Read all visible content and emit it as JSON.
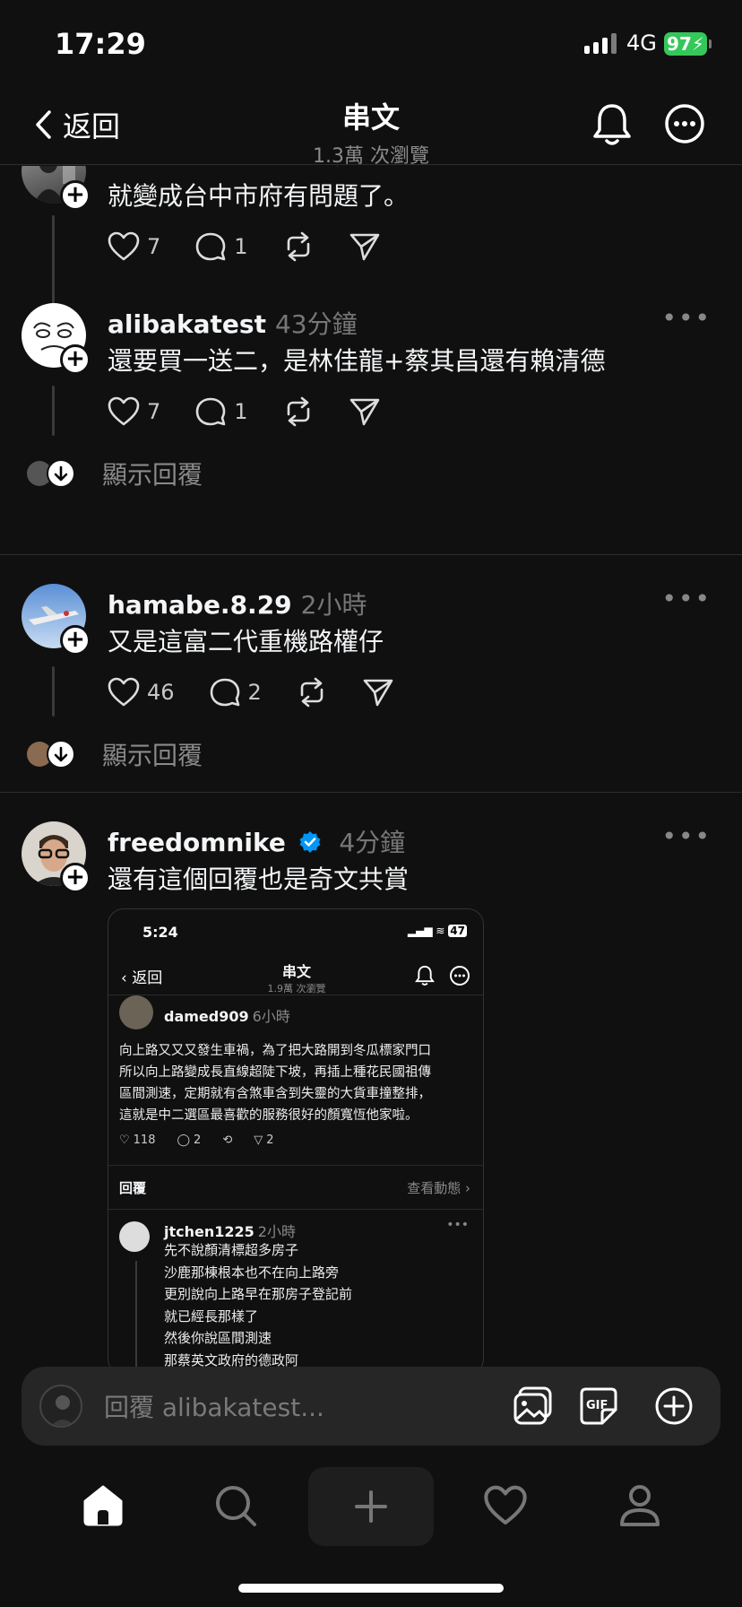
{
  "status": {
    "time": "17:29",
    "network": "4G",
    "battery": "97"
  },
  "header": {
    "back_label": "返回",
    "title": "串文",
    "subtitle": "1.3萬 次瀏覽"
  },
  "posts": [
    {
      "username": "",
      "time": "",
      "text": "如果市長還是林佳龍，\n就變成台中市府有問題了。",
      "likes": "7",
      "replies": "1"
    },
    {
      "username": "alibakatest",
      "time": "43分鐘",
      "text": "還要買一送二，是林佳龍+蔡其昌還有賴清德",
      "likes": "7",
      "replies": "1",
      "show_replies": "顯示回覆"
    },
    {
      "username": "hamabe.8.29",
      "time": "2小時",
      "text": "又是這富二代重機路權仔",
      "likes": "46",
      "replies": "2",
      "show_replies": "顯示回覆"
    },
    {
      "username": "freedomnike",
      "time": "4分鐘",
      "text": "還有這個回覆也是奇文共賞",
      "verified": true
    }
  ],
  "embedded": {
    "status_time": "5:24",
    "battery": "47",
    "back_label": "返回",
    "title": "串文",
    "subtitle": "1.9萬 次瀏覽",
    "post_user": "damed909",
    "post_time": "6小時",
    "post_text": "向上路又又又發生車禍，為了把大路開到冬瓜標家門口\n所以向上路變成長直線超陡下坡，再插上種花民國祖傳\n區間測速，定期就有含煞車含到失靈的大貨車撞整排，\n這就是中二選區最喜歡的服務很好的顏寬恆他家啦。",
    "likes": "118",
    "replies": "2",
    "shares": "2",
    "reply_label": "回覆",
    "activity_label": "查看動態",
    "reply_user": "jtchen1225",
    "reply_time": "2小時",
    "reply_text": "先不說顏清標超多房子\n沙鹿那棟根本也不在向上路旁\n更別說向上路早在那房子登記前\n就已經長那樣了\n然後你說區間測速\n那蔡英文政府的德政阿"
  },
  "composer": {
    "placeholder": "回覆 alibakatest..."
  },
  "colors": {
    "background": "#101010",
    "battery": "#34c759",
    "verified": "#0095f6"
  }
}
